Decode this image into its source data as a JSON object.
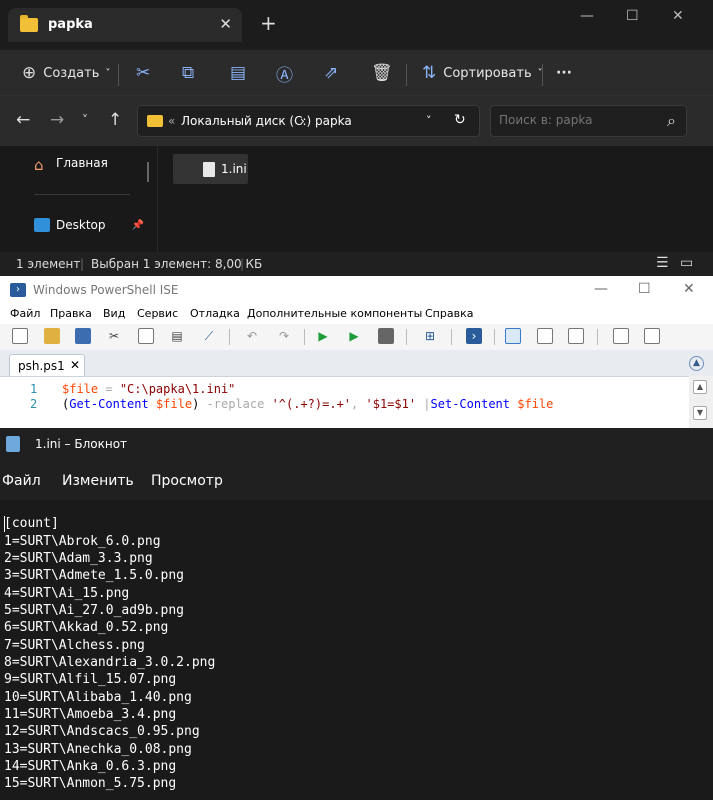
{
  "explorer": {
    "tab_title": "papka",
    "tab_close": "✕",
    "new_tab": "+",
    "window_controls": [
      "—",
      "☐",
      "✕"
    ],
    "commands": {
      "create": "Создать",
      "sort": "Сортировать",
      "more": "···",
      "chevron": "˅"
    },
    "address": {
      "prefix": "«",
      "disk": "Локальный диск (C:)",
      "sep": "›",
      "folder": "papka",
      "dropdown": "˅",
      "refresh": "↻"
    },
    "search_placeholder": "Поиск в: papka",
    "sidebar": [
      {
        "label": "Главная",
        "icon": "home-icon"
      },
      {
        "label": "Desktop",
        "icon": "desktop-icon"
      }
    ],
    "pin": "📌",
    "file": {
      "name": "1.ini"
    },
    "status": {
      "count": "1 элемент",
      "selected": "Выбран 1 элемент: 8,00 КБ"
    }
  },
  "ise": {
    "title": "Windows PowerShell ISE",
    "window_controls": [
      "—",
      "☐",
      "✕"
    ],
    "menu": [
      "Файл",
      "Правка",
      "Вид",
      "Сервис",
      "Отладка",
      "Дополнительные компоненты",
      "Справка"
    ],
    "tab": {
      "name": "psh.ps1",
      "close": "✕"
    },
    "line_numbers": [
      "1",
      "2"
    ],
    "code": {
      "l1_var": "$file",
      "l1_eq": " = ",
      "l1_str": "\"C:\\papka\\1.ini\"",
      "l2_open": "(",
      "l2_cmd1": "Get-Content",
      "l2_sp1": " ",
      "l2_var1": "$file",
      "l2_close": ")",
      "l2_op": " -replace ",
      "l2_str1": "'^(.+?)=.+'",
      "l2_comma": ", ",
      "l2_str2": "'$1=$1'",
      "l2_pipe": " |",
      "l2_cmd2": "Set-Content",
      "l2_sp2": " ",
      "l2_var2": "$file"
    }
  },
  "notepad": {
    "title": "1.ini – Блокнот",
    "menu": [
      "Файл",
      "Изменить",
      "Просмотр"
    ],
    "lines": [
      "[count]",
      "1=SURT\\Abrok_6.0.png",
      "2=SURT\\Adam_3.3.png",
      "3=SURT\\Admete_1.5.0.png",
      "4=SURT\\Ai_15.png",
      "5=SURT\\Ai_27.0_ad9b.png",
      "6=SURT\\Akkad_0.52.png",
      "7=SURT\\Alchess.png",
      "8=SURT\\Alexandria_3.0.2.png",
      "9=SURT\\Alfil_15.07.png",
      "10=SURT\\Alibaba_1.40.png",
      "11=SURT\\Amoeba_3.4.png",
      "12=SURT\\Andscacs_0.95.png",
      "13=SURT\\Anechka_0.08.png",
      "14=SURT\\Anka_0.6.3.png",
      "15=SURT\\Anmon_5.75.png"
    ]
  }
}
